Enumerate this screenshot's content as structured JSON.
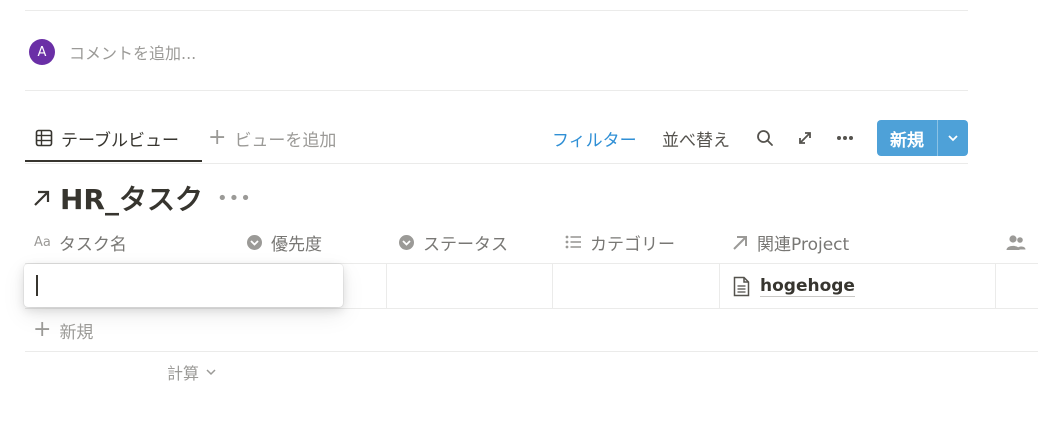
{
  "comment": {
    "avatar_initial": "A",
    "avatar_color": "#6a2fa6",
    "placeholder": "コメントを追加..."
  },
  "views": {
    "active_tab": "テーブルビュー",
    "add_view": "ビューを追加"
  },
  "toolbar": {
    "filter": "フィルター",
    "sort": "並べ替え",
    "icons": [
      "search-icon",
      "expand-icon",
      "more-icon"
    ],
    "new_button": "新規",
    "accent": "#4ea1d8",
    "filter_color": "#2f8fd5"
  },
  "database": {
    "title": "HR_タスク",
    "columns": [
      {
        "label": "タスク名",
        "icon": "text-icon",
        "type_badge": "Aa"
      },
      {
        "label": "優先度",
        "icon": "select-icon"
      },
      {
        "label": "ステータス",
        "icon": "select-icon"
      },
      {
        "label": "カテゴリー",
        "icon": "multi-select-icon"
      },
      {
        "label": "関連Project",
        "icon": "relation-icon"
      },
      {
        "label": "",
        "icon": "person-icon"
      }
    ],
    "rows": [
      {
        "task": "",
        "priority": "",
        "status": "",
        "category": "",
        "related": "hogehoge"
      }
    ],
    "new_row": "新規",
    "calculate": "計算"
  }
}
